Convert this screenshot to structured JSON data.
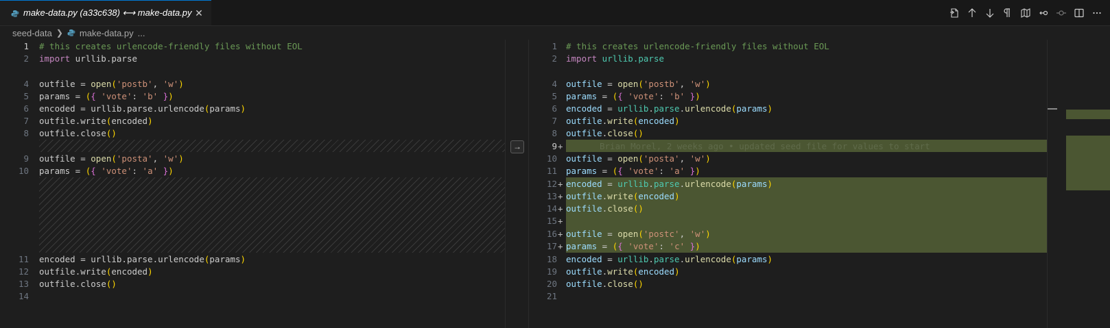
{
  "tab": {
    "title": "make-data.py (a33c638) ⟷ make-data.py",
    "close": "✕"
  },
  "breadcrumb": {
    "folder": "seed-data",
    "file": "make-data.py",
    "more": "..."
  },
  "toolbar": {
    "icons": [
      "open-file-icon",
      "previous-change-icon",
      "next-change-icon",
      "whitespace-icon",
      "map-icon",
      "git-compare-icon",
      "git-commit-icon",
      "split-editor-icon",
      "more-icon"
    ]
  },
  "left_lines": [
    {
      "n": "1"
    },
    {
      "n": "2"
    },
    {
      "n": "4"
    },
    {
      "n": "5"
    },
    {
      "n": "6"
    },
    {
      "n": "7"
    },
    {
      "n": "8"
    },
    {
      "n": "9"
    },
    {
      "n": "10"
    },
    {
      "n": "11"
    },
    {
      "n": "12"
    },
    {
      "n": "13"
    },
    {
      "n": "14"
    }
  ],
  "right_lines": [
    {
      "n": "1"
    },
    {
      "n": "2"
    },
    {
      "n": "4"
    },
    {
      "n": "5"
    },
    {
      "n": "6"
    },
    {
      "n": "7"
    },
    {
      "n": "8"
    },
    {
      "n": "9"
    },
    {
      "n": "10"
    },
    {
      "n": "11"
    },
    {
      "n": "12"
    },
    {
      "n": "13"
    },
    {
      "n": "14"
    },
    {
      "n": "15"
    },
    {
      "n": "16"
    },
    {
      "n": "17"
    },
    {
      "n": "18"
    },
    {
      "n": "19"
    },
    {
      "n": "20"
    },
    {
      "n": "21"
    }
  ],
  "code": {
    "l1": "# this creates urlencode-friendly files without EOL",
    "import_kw": "import",
    "import_mod": " urllib.parse",
    "outfile": "outfile",
    "params": "params",
    "encoded": "encoded",
    "eq": " = ",
    "open": "open",
    "postb": "'postb'",
    "posta": "'posta'",
    "postc": "'postc'",
    "w": "'w'",
    "comma": ", ",
    "vote": "'vote'",
    "b": "'b'",
    "a": "'a'",
    "c": "'c'",
    "urllib": "urllib",
    "parse": "parse",
    "urlencode": "urlencode",
    "write": "write",
    "close": "close",
    "blame": "Brian Morel, 2 weeks ago • updated seed file for values to start"
  },
  "plus": "+",
  "arrow": "→"
}
